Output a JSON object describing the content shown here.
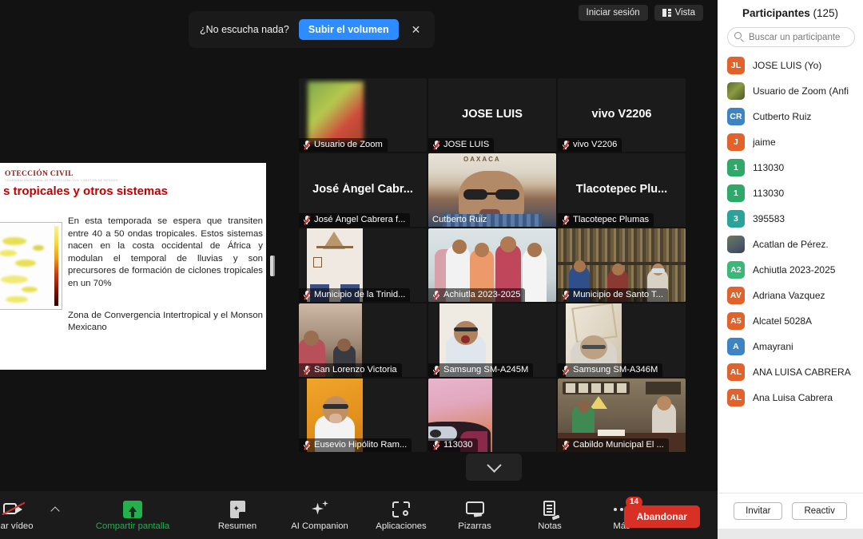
{
  "header": {
    "sign_in_label": "Iniciar sesión",
    "view_label": "Vista"
  },
  "toast": {
    "message": "¿No escucha nada?",
    "cta_label": "Subir el volumen",
    "close_label": "✕"
  },
  "shared_screen": {
    "org_line1": "OTECCIÓN CIVIL",
    "org_line2": "COORDINACIÓN ESTATAL DE PROTECCIÓN CIVIL Y GESTIÓN DE RIESGOS",
    "title": "s  tropicales y otros sistemas",
    "paragraph1": "En esta temporada se espera que transiten entre 40 a 50 ondas tropicales. Estos sistemas nacen en la costa occidental de África y modulan el temporal de lluvias y son precursores de formación de ciclones tropicales en un 70%",
    "paragraph2": "Zona de Convergencia Intertropical y el Monson Mexicano"
  },
  "gallery": {
    "scroll_down_label": "⌄",
    "tiles": [
      {
        "name": "Usuario de Zoom",
        "display": "Usuario de Zoom",
        "muted": true,
        "video": true,
        "active": false,
        "kind": "avatar-blur"
      },
      {
        "name": "JOSE LUIS",
        "display": "JOSE LUIS",
        "muted": true,
        "video": false,
        "active": false,
        "kind": "name-only"
      },
      {
        "name": "vivo V2206",
        "display": "vivo V2206",
        "muted": true,
        "video": false,
        "active": false,
        "kind": "name-only"
      },
      {
        "name": "José Ángel Cabrera f...",
        "display": "José Ángel Cabr...",
        "muted": true,
        "video": false,
        "active": false,
        "kind": "name-only"
      },
      {
        "name": "Cutberto Ruiz",
        "display": "Cutberto Ruiz",
        "muted": false,
        "video": true,
        "active": true,
        "kind": "video-man-oaxaca"
      },
      {
        "name": "Tlacotepec Plumas",
        "display": "Tlacotepec  Plu...",
        "muted": true,
        "video": false,
        "active": false,
        "kind": "name-only"
      },
      {
        "name": "Municipio de la Trinid...",
        "display": "Municipio de la Trinid...",
        "muted": true,
        "video": true,
        "active": false,
        "kind": "video-room-chairs"
      },
      {
        "name": "Achiutla 2023-2025",
        "display": "Achiutla 2023-2025",
        "muted": true,
        "video": true,
        "active": false,
        "kind": "video-group-four"
      },
      {
        "name": "Municipio de Santo T...",
        "display": "Municipio de Santo T...",
        "muted": true,
        "video": true,
        "active": false,
        "kind": "video-archive"
      },
      {
        "name": "San Lorenzo Victoria",
        "display": "San Lorenzo Victoria",
        "muted": true,
        "video": true,
        "active": false,
        "kind": "video-room-group"
      },
      {
        "name": "Samsung SM-A245M",
        "display": "Samsung SM-A245M",
        "muted": true,
        "video": true,
        "active": false,
        "kind": "video-man-blue"
      },
      {
        "name": "Samsung SM-A346M",
        "display": "Samsung SM-A346M",
        "muted": true,
        "video": true,
        "active": false,
        "kind": "video-man-elder"
      },
      {
        "name": "Eusevio Hipólito Ram...",
        "display": "Eusevio Hipólito Ram...",
        "muted": true,
        "video": true,
        "active": false,
        "kind": "video-yellow-wall"
      },
      {
        "name": "113030",
        "display": "113030",
        "muted": true,
        "video": true,
        "active": false,
        "kind": "video-pink"
      },
      {
        "name": "Cabildo Municipal El ...",
        "display": "Cabildo Municipal El ...",
        "muted": true,
        "video": true,
        "active": false,
        "kind": "video-office"
      }
    ]
  },
  "toolbar": {
    "items": [
      {
        "label": "ciar vídeo",
        "icon": "camera-off-icon",
        "id": "video"
      },
      {
        "label": "Compartir pantalla",
        "icon": "share-screen-icon",
        "id": "share"
      },
      {
        "label": "Resumen",
        "icon": "summary-doc-icon",
        "id": "summary"
      },
      {
        "label": "AI Companion",
        "icon": "sparkle-icon",
        "id": "ai"
      },
      {
        "label": "Aplicaciones",
        "icon": "apps-icon",
        "id": "apps"
      },
      {
        "label": "Pizarras",
        "icon": "whiteboard-icon",
        "id": "boards"
      },
      {
        "label": "Notas",
        "icon": "notes-icon",
        "id": "notes"
      },
      {
        "label": "Más",
        "icon": "more-dots-icon",
        "id": "more",
        "badge": "14"
      }
    ],
    "leave_label": "Abandonar"
  },
  "participants": {
    "title_label": "Participantes",
    "count_label": "(125)",
    "search_placeholder": "Buscar un participante",
    "invite_label": "Invitar",
    "unmute_label": "Reactiv",
    "rows": [
      {
        "name": "JOSE LUIS (Yo)",
        "initials": "JL",
        "color": "#e2622a"
      },
      {
        "name": "Usuario de Zoom (Anfi",
        "initials": "",
        "color": "photo2"
      },
      {
        "name": "Cutberto Ruiz",
        "initials": "CR",
        "color": "#3d84c6"
      },
      {
        "name": "jaime",
        "initials": "J",
        "color": "#e2622a"
      },
      {
        "name": "113030",
        "initials": "1",
        "color": "#2fa96a"
      },
      {
        "name": "113030",
        "initials": "1",
        "color": "#2fa96a"
      },
      {
        "name": "395583",
        "initials": "3",
        "color": "#2aa39a"
      },
      {
        "name": "Acatlan de Pérez.",
        "initials": "",
        "color": "photo"
      },
      {
        "name": "Achiutla 2023-2025",
        "initials": "A2",
        "color": "#3ab878"
      },
      {
        "name": "Adriana Vazquez",
        "initials": "AV",
        "color": "#e2622a"
      },
      {
        "name": "Alcatel 5028A",
        "initials": "A5",
        "color": "#e2622a"
      },
      {
        "name": "Amayrani",
        "initials": "A",
        "color": "#3d84c6"
      },
      {
        "name": "ANA LUISA CABRERA",
        "initials": "AL",
        "color": "#e2622a"
      },
      {
        "name": "Ana Luisa Cabrera",
        "initials": "AL",
        "color": "#e2622a"
      }
    ]
  },
  "colors": {
    "accent_blue": "#2d8cff",
    "leave_red": "#d93025",
    "share_green": "#22b14c",
    "active_border": "#c3f53c",
    "badge_red": "#e02b20"
  }
}
